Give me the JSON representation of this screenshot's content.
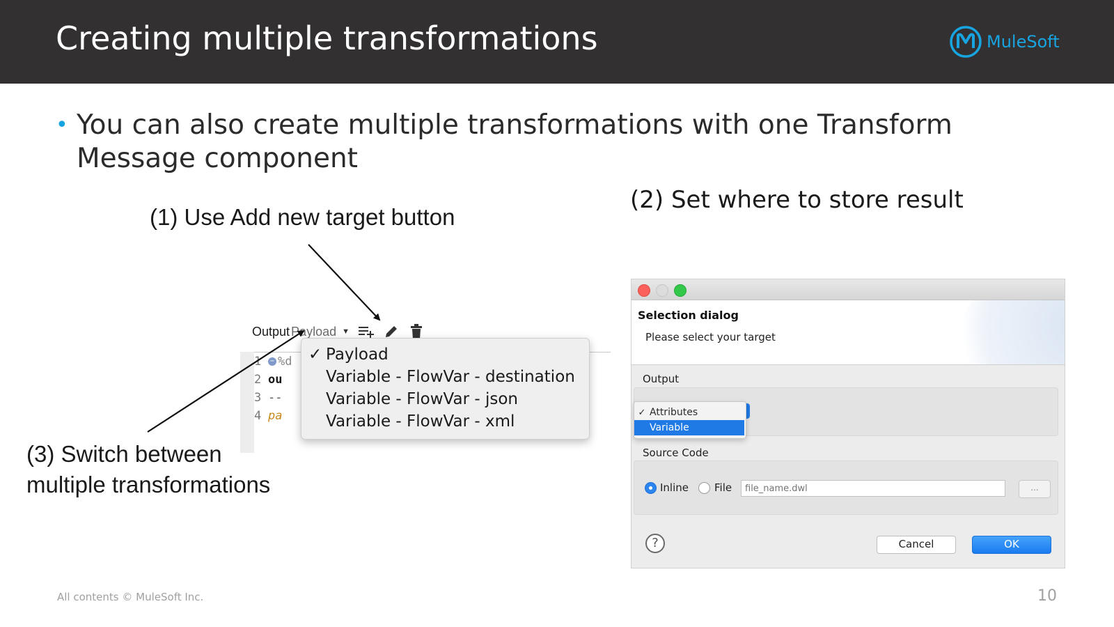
{
  "header": {
    "title": "Creating multiple transformations",
    "logo_text": "MuleSoft"
  },
  "bullet": {
    "text": "You can also create multiple transformations with one Transform Message component"
  },
  "callouts": {
    "one": "(1) Use Add new target button",
    "two": "(2) Set where to store result",
    "three_line1": "(3) Switch between",
    "three_line2": "multiple transformations"
  },
  "left_screenshot": {
    "output_label": "Output",
    "selected_target": "Payload",
    "code_lines": [
      {
        "num": "1",
        "text": "%d"
      },
      {
        "num": "2",
        "text": "ou"
      },
      {
        "num": "3",
        "text": "--"
      },
      {
        "num": "4",
        "text": "pa"
      }
    ],
    "dropdown_items": [
      "Payload",
      "Variable - FlowVar - destination",
      "Variable - FlowVar - json",
      "Variable - FlowVar - xml"
    ],
    "checked_item": "Payload"
  },
  "dialog": {
    "title": "Selection dialog",
    "subtitle": "Please select your target",
    "output_label": "Output",
    "target_options": [
      "Attributes",
      "Variable"
    ],
    "checked_option": "Attributes",
    "highlighted_option": "Variable",
    "source_code_label": "Source Code",
    "radio_inline": "Inline",
    "radio_file": "File",
    "selected_radio": "Inline",
    "file_name_placeholder": "file_name.dwl",
    "browse_label": "...",
    "help_label": "?",
    "cancel_label": "Cancel",
    "ok_label": "OK"
  },
  "footer": {
    "copyright": "All contents © MuleSoft Inc.",
    "page_number": "10"
  },
  "colors": {
    "header_bg": "#323031",
    "brand_blue": "#17a4e0",
    "dialog_accent": "#1f7ae6"
  }
}
